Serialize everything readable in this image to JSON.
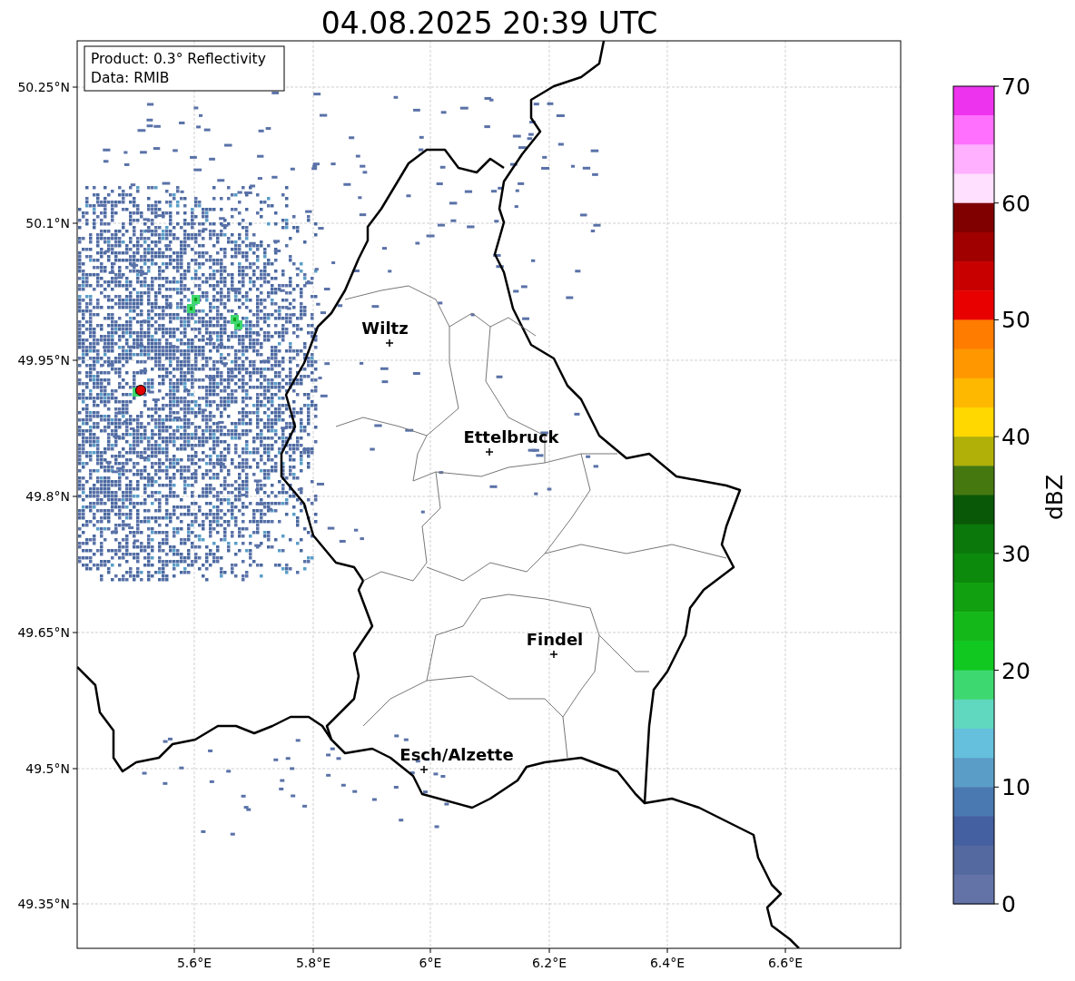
{
  "title": "04.08.2025 20:39 UTC",
  "info_box": [
    "Product: 0.3° Reflectivity",
    "Data: RMIB"
  ],
  "cities": [
    {
      "name": "Wiltz"
    },
    {
      "name": "Ettelbruck"
    },
    {
      "name": "Findel"
    },
    {
      "name": "Esch/Alzette"
    }
  ],
  "x_ticks": [
    "5.6°E",
    "5.8°E",
    "6°E",
    "6.2°E",
    "6.4°E",
    "6.6°E"
  ],
  "y_ticks": [
    "50.25°N",
    "50.1°N",
    "49.95°N",
    "49.8°N",
    "49.65°N",
    "49.5°N",
    "49.35°N"
  ],
  "colorbar": {
    "label": "dBZ",
    "ticks": [
      "70",
      "60",
      "50",
      "40",
      "30",
      "20",
      "10",
      "0"
    ],
    "bins": [
      {
        "color": "#ee33ee"
      },
      {
        "color": "#ff70ff"
      },
      {
        "color": "#ffb0ff"
      },
      {
        "color": "#ffe0ff"
      },
      {
        "color": "#800000"
      },
      {
        "color": "#a00000"
      },
      {
        "color": "#c80000"
      },
      {
        "color": "#e80000"
      },
      {
        "color": "#ff7c00"
      },
      {
        "color": "#ff9800"
      },
      {
        "color": "#ffb800"
      },
      {
        "color": "#ffd800"
      },
      {
        "color": "#b0b008"
      },
      {
        "color": "#467810"
      },
      {
        "color": "#085808"
      },
      {
        "color": "#0a780a"
      },
      {
        "color": "#0c8a0c"
      },
      {
        "color": "#10a010"
      },
      {
        "color": "#14b818"
      },
      {
        "color": "#10c820"
      },
      {
        "color": "#3ed870"
      },
      {
        "color": "#60d8c0"
      },
      {
        "color": "#64c0dc"
      },
      {
        "color": "#5a9ec8"
      },
      {
        "color": "#4a78b0"
      },
      {
        "color": "#4560a0"
      },
      {
        "color": "#54699f"
      },
      {
        "color": "#6373a8"
      }
    ]
  }
}
